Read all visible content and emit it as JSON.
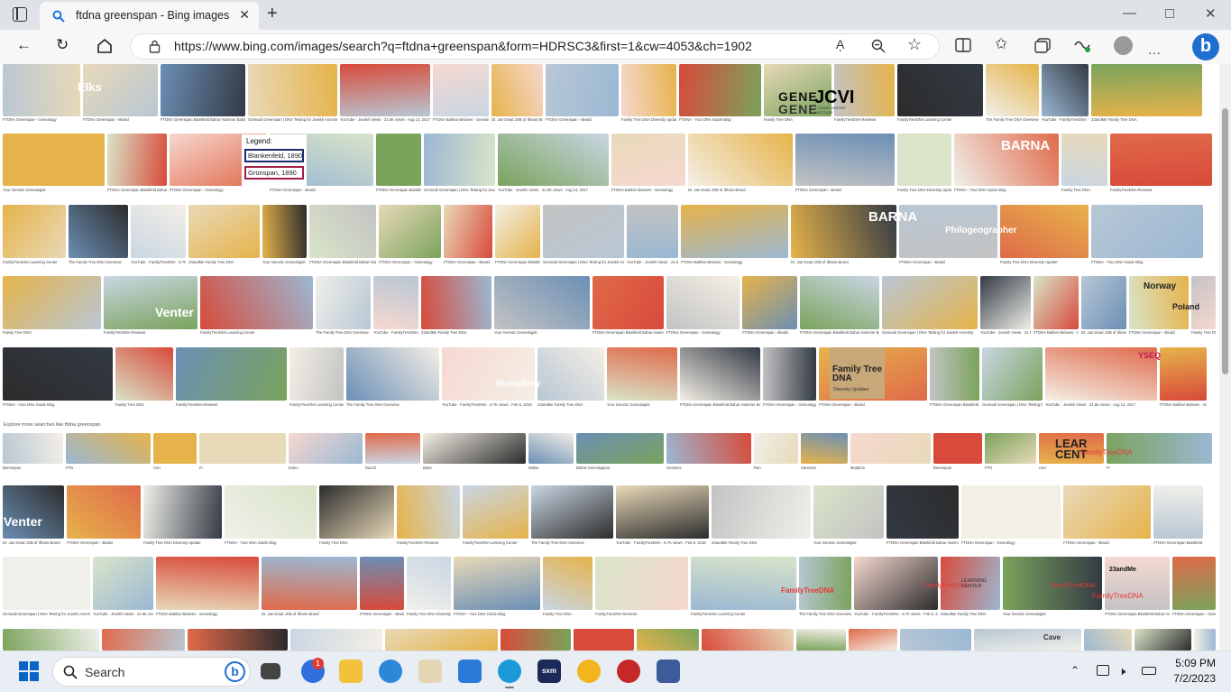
{
  "browser": {
    "tab_title": "ftdna greenspan - Bing images",
    "url": "https://www.bing.com/images/search?q=ftdna+greenspan&form=HDRSC3&first=1&cw=4053&ch=1902",
    "reader_label": "Aͅ"
  },
  "results": {
    "explore_label": "Explore more searches like ftdna greenspan",
    "captions": [
      "FTDNA Greenspan - Genealogy",
      "FTDNA Greenspan - Bivald",
      "FTDNA Greenspan Blankfeld Bahar Hammer Babas Walsh - Genealogy",
      "Gennadi Greenspan | DNA Testing for Jewish Ancestry",
      "YouTube · Jewish Views · 21.6K views · Aug 14, 2017",
      "FTDNA Bakhar Belaves - Genealogy",
      "Dr. Jan Dead JOB of Illinois Brand",
      "FTDNA Greenspan - Bivald",
      "Family Tree DNA Diversity Update",
      "FTDNA - Your DNA Guide Blog",
      "Family Tree DNA",
      "FamilyTreeDNA Reviews",
      "FamilyTreeDNA Learning Center",
      "The Family Tree DNA Overview",
      "YouTube · FamilyTreeDNA · 8.7K views · Feb 6, 2018",
      "23andMe Family Tree DNA",
      "Your Genetic Genealogist",
      "FTDNA Greenspan Blankfeld Bahar Hammer Babas Walsh - Gen Grealer"
    ],
    "related": [
      "Berenspan",
      "FTD",
      "Cerr",
      "Fr",
      "Eulen",
      "Rauch",
      "Bahe",
      "Walse",
      "Bahar Genealogical",
      "Genetics",
      "Ran",
      "Harwood",
      "Mutation"
    ],
    "overlay": {
      "legend_title": "Legend:",
      "legend_1": "Blankenfeld, 1890",
      "legend_2": "Grünspan, 1890",
      "elis": "Elks",
      "venter": "Venter",
      "barna": "BARNA",
      "philo": "Philogeographer",
      "humphrey": "Humphrey",
      "ftdna_card": "Family Tree DNA",
      "ftdna_card_sub": "Diversity Updates",
      "gene": "GENE",
      "gene2": "GENE",
      "jcvi": "JCVI",
      "jcvi_sub": "J. CRAIG VENTER INSTITUTE",
      "ysseq": "YSEQ",
      "ftdna_logo": "FamilyTreeDNA",
      "learning": "LEARNING CENTER",
      "learn": "LEAR CENT",
      "ttd": "23andMe",
      "norway": "Norway",
      "poland": "Poland",
      "ypse": "YSEQ",
      "ysio": "YSEO",
      "cave": "Cave"
    }
  },
  "taskbar": {
    "search_label": "Search",
    "time": "5:09 PM",
    "date": "7/2/2023",
    "notif_count": "1",
    "sxm_label": "sxm"
  }
}
